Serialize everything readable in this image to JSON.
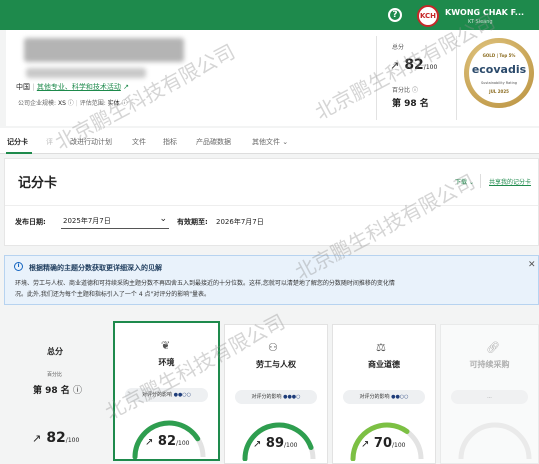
{
  "topbar": {
    "help": "?",
    "avatar": "KCH",
    "user_name": "KWONG CHAK F...",
    "user_sub": "KT Sieang"
  },
  "summary": {
    "country": "中国",
    "industry": "其他专业、科学和技术活动",
    "size_label": "公司企业规模:",
    "size_value": "XS",
    "scope_label": "评估范围:",
    "scope_value": "实体",
    "score_label": "总分",
    "score": "82",
    "score_max": "/100",
    "percentile_label": "百分比",
    "rank": "第 98 名"
  },
  "badge": {
    "tier": "GOLD | Top 5%",
    "brand": "ecovadis",
    "sub": "Sustainability Rating",
    "date": "JUL 2025"
  },
  "tabs": [
    {
      "label": "记分卡"
    },
    {
      "label": "评"
    },
    {
      "label": "改进行动计划"
    },
    {
      "label": "文件"
    },
    {
      "label": "指标"
    },
    {
      "label": "产品碳数据"
    },
    {
      "label": "其他文件"
    }
  ],
  "scorecard": {
    "title": "记分卡",
    "download": "下载",
    "share": "共享我的记分卡",
    "publish_label": "发布日期:",
    "publish_date": "2025年7月7日",
    "expiry_label": "有效期至:",
    "expiry_date": "2026年7月7日"
  },
  "info": {
    "title": "根据精确的主题分数获取更详细深入的见解",
    "line1": "环境、劳工与人权、商业道德和可持续采购主题分数不再四舍五入到最接近的十分位数。这样,您就可以清楚地了解您的分数随时间推移的变化情",
    "line2": "况。此外,我们还为每个主题和指标引入了一个 4 点\"对评分的影响\"量表。"
  },
  "overall": {
    "label": "总分",
    "pct_label": "百分比",
    "rank": "第 98 名",
    "score": "82",
    "max": "/100"
  },
  "categories": [
    {
      "name": "环境",
      "impact": "对评分的影响",
      "score": "82",
      "max": "/100",
      "value": 82,
      "dots": 3
    },
    {
      "name": "劳工与人权",
      "impact": "对评分的影响",
      "score": "89",
      "max": "/100",
      "value": 89,
      "dots": 3
    },
    {
      "name": "商业道德",
      "impact": "对评分的影响",
      "score": "70",
      "max": "/100",
      "value": 70,
      "dots": 2
    },
    {
      "name": "可持续采购",
      "impact": "...",
      "score": "",
      "max": "",
      "value": 0,
      "dots": 0
    }
  ],
  "watermark": "北京鹏生科技有限公司",
  "colors": {
    "brand": "#1e8a4c",
    "gauge_green": "#2e9e4f",
    "gauge_lime": "#7cc043",
    "gold": "#c9a24a"
  }
}
